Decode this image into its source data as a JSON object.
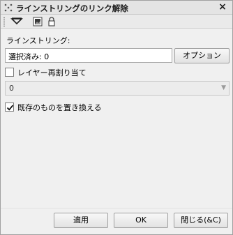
{
  "window": {
    "title": "ラインストリングのリンク解除",
    "close_glyph": "×"
  },
  "toolbar": {
    "icons": [
      "filter-funnel-icon",
      "image-icon",
      "lock-icon"
    ]
  },
  "form": {
    "linestring_label": "ラインストリング:",
    "selection_value": "選択済み: 0",
    "options_button": "オプション",
    "reassign_layer_label": "レイヤー再割り当て",
    "reassign_layer_checked": false,
    "layer_select_value": "0",
    "replace_existing_label": "既存のものを置き換える",
    "replace_existing_checked": true
  },
  "footer": {
    "apply_button": "適用",
    "ok_button": "OK",
    "close_button": "閉じる(&C)"
  }
}
